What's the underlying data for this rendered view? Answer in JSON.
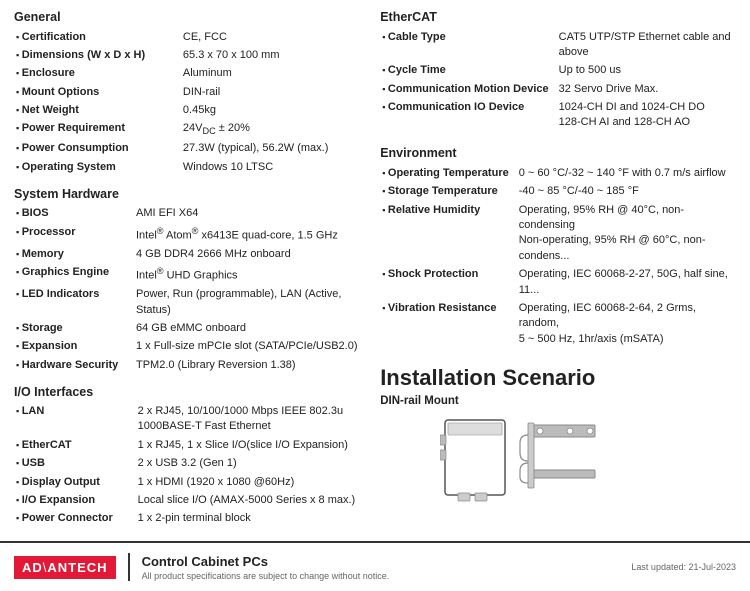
{
  "general": {
    "title": "General",
    "items": [
      {
        "label": "Certification",
        "value": "CE, FCC"
      },
      {
        "label": "Dimensions (W x D x H)",
        "value": "65.3 x 70 x 100 mm"
      },
      {
        "label": "Enclosure",
        "value": "Aluminum"
      },
      {
        "label": "Mount Options",
        "value": "DIN-rail"
      },
      {
        "label": "Net Weight",
        "value": "0.45kg"
      },
      {
        "label": "Power Requirement",
        "value": "24VDC ± 20%"
      },
      {
        "label": "Power Consumption",
        "value": "27.3W (typical), 56.2W (max.)"
      },
      {
        "label": "Operating System",
        "value": "Windows 10 LTSC"
      }
    ]
  },
  "system_hardware": {
    "title": "System Hardware",
    "items": [
      {
        "label": "BIOS",
        "value": "AMI EFI X64"
      },
      {
        "label": "Processor",
        "value": "Intel® Atom® x6413E quad-core, 1.5 GHz"
      },
      {
        "label": "Memory",
        "value": "4 GB DDR4 2666 MHz onboard"
      },
      {
        "label": "Graphics Engine",
        "value": "Intel® UHD Graphics"
      },
      {
        "label": "LED Indicators",
        "value": "Power, Run (programmable), LAN (Active, Status)"
      },
      {
        "label": "Storage",
        "value": "64 GB eMMC onboard"
      },
      {
        "label": "Expansion",
        "value": "1 x Full-size mPCIe slot (SATA/PCIe/USB2.0)"
      },
      {
        "label": "Hardware Security",
        "value": "TPM2.0 (Library Reversion 1.38)"
      }
    ]
  },
  "io_interfaces": {
    "title": "I/O Interfaces",
    "items": [
      {
        "label": "LAN",
        "value": "2 x RJ45, 10/100/1000 Mbps IEEE 802.3u\n1000BASE-T Fast Ethernet"
      },
      {
        "label": "EtherCAT",
        "value": "1 x RJ45, 1 x Slice I/O(slice I/O Expansion)"
      },
      {
        "label": "USB",
        "value": "2 x USB 3.2 (Gen 1)"
      },
      {
        "label": "Display Output",
        "value": "1 x HDMI (1920 x 1080 @60Hz)"
      },
      {
        "label": "I/O Expansion",
        "value": "Local slice I/O (AMAX-5000 Series x 8 max.)"
      },
      {
        "label": "Power Connector",
        "value": "1 x 2-pin terminal block"
      }
    ]
  },
  "ethercat": {
    "title": "EtherCAT",
    "items": [
      {
        "label": "Cable Type",
        "value": "CAT5 UTP/STP Ethernet cable and above"
      },
      {
        "label": "Cycle Time",
        "value": "Up to 500 us"
      },
      {
        "label": "Communication Motion Device",
        "value": "32 Servo Drive Max."
      },
      {
        "label": "Communication IO Device",
        "value": "1024-CH DI and 1024-CH DO\n128-CH AI and 128-CH AO"
      }
    ]
  },
  "environment": {
    "title": "Environment",
    "items": [
      {
        "label": "Operating Temperature",
        "value": "0 ~ 60 °C/-32 ~ 140 °F with 0.7 m/s airflow"
      },
      {
        "label": "Storage Temperature",
        "value": "-40 ~ 85 °C/-40 ~ 185 °F"
      },
      {
        "label": "Relative Humidity",
        "value": "Operating, 95% RH @ 40°C, non-condensing\nNon-operating, 95% RH @ 60°C, non-condens..."
      },
      {
        "label": "Shock Protection",
        "value": "Operating, IEC 60068-2-27, 50G, half sine, 11..."
      },
      {
        "label": "Vibration Resistance",
        "value": "Operating, IEC 60068-2-64, 2 Grms, random,\n5 ~ 500 Hz, 1hr/axis (mSATA)"
      }
    ]
  },
  "installation": {
    "title": "Installation Scenario",
    "subtitle": "DIN-rail Mount"
  },
  "footer": {
    "logo_text": "AD\\ANTECH",
    "logo_display": "AD ANTECH",
    "logo_slash": "\\",
    "product_category": "Control Cabinet PCs",
    "note": "All product specifications are subject to change without notice.",
    "updated": "Last updated: 21-Jul-2023"
  }
}
